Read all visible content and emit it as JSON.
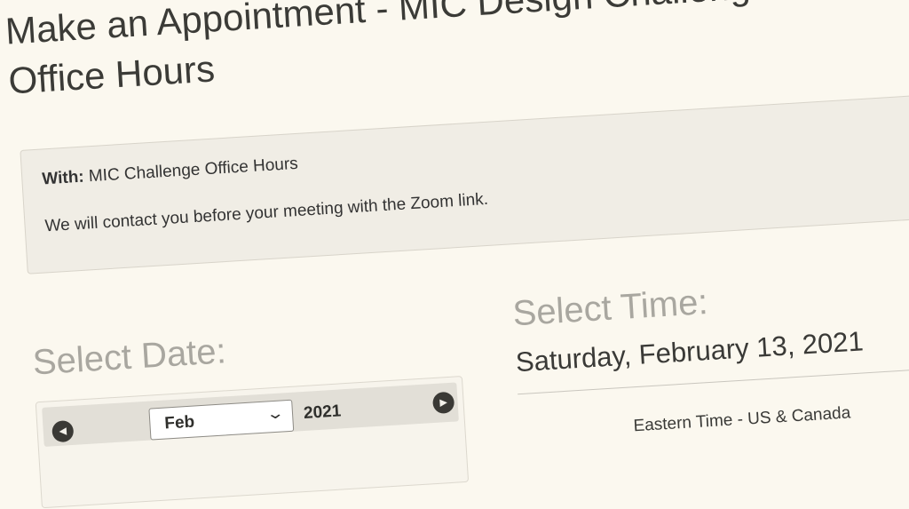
{
  "header": {
    "title_line1": "Make an Appointment - MIC Design Challenge",
    "title_line2": "Office Hours"
  },
  "info": {
    "with_label": "With:",
    "with_value": "MIC Challenge Office Hours",
    "note": "We will contact you before your meeting with the Zoom link."
  },
  "date_section": {
    "heading": "Select Date:",
    "calendar": {
      "prev_icon": "chevron-left",
      "next_icon": "chevron-right",
      "month_selected": "Feb",
      "year": "2021"
    }
  },
  "time_section": {
    "heading": "Select Time:",
    "selected_date": "Saturday, February 13, 2021",
    "timezone": "Eastern Time - US & Canada"
  },
  "colors": {
    "page_bg": "#fbf8ef",
    "info_box_bg": "#f0ede5",
    "heading_muted": "#a9a7a0",
    "nav_button": "#3a3935"
  }
}
